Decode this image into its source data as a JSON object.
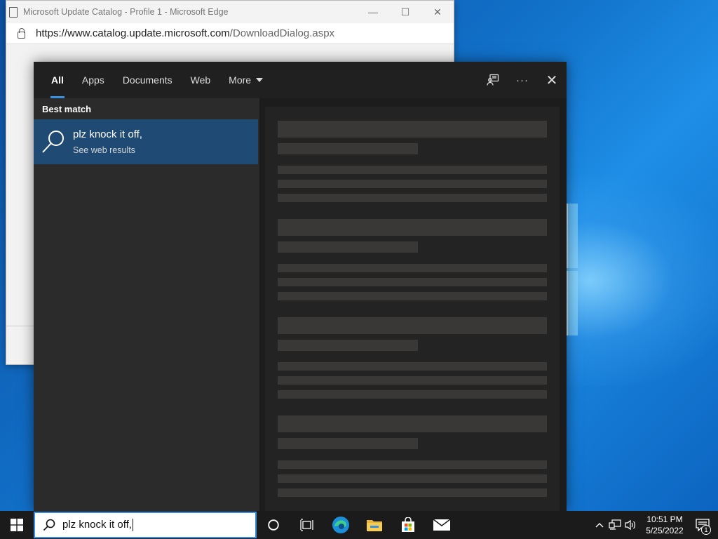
{
  "edge_window": {
    "title": "Microsoft Update Catalog - Profile 1 - Microsoft Edge",
    "url_host": "https://www.catalog.update.microsoft.com",
    "url_path": "/DownloadDialog.aspx",
    "controls": {
      "minimize": "—",
      "maximize": "☐",
      "close": "✕"
    }
  },
  "search_panel": {
    "tabs": [
      {
        "label": "All",
        "active": true
      },
      {
        "label": "Apps"
      },
      {
        "label": "Documents"
      },
      {
        "label": "Web"
      },
      {
        "label": "More"
      }
    ],
    "section_header": "Best match",
    "best_match": {
      "title": "plz knock it off,",
      "subtitle": "See web results",
      "icon": "search-icon"
    },
    "actions": {
      "feedback_icon": "feedback-icon",
      "more_icon": "more-options-icon",
      "close_icon": "close-icon",
      "more_glyph": "···",
      "close_glyph": "✕"
    }
  },
  "taskbar": {
    "search_value": "plz knock it off,",
    "apps": [
      "cortana-icon",
      "task-view-icon",
      "edge-icon",
      "file-explorer-icon",
      "store-icon",
      "mail-icon"
    ],
    "clock": {
      "time": "10:51 PM",
      "date": "5/25/2022"
    },
    "notification_count": "1"
  },
  "colors": {
    "accent": "#3a8fe0",
    "selected_result": "#1f4a73",
    "panel_bg": "#2b2b2b",
    "taskbar_bg": "#1b1b1b"
  }
}
